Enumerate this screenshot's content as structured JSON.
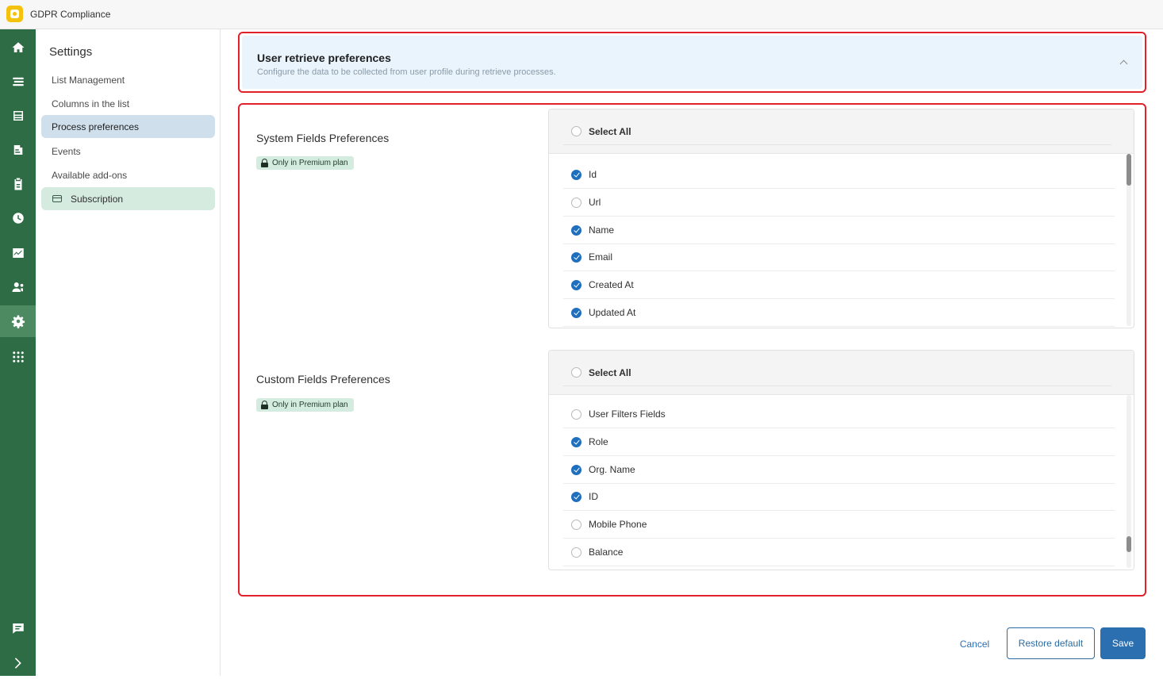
{
  "app": {
    "title": "GDPR Compliance"
  },
  "rail": {
    "items": [
      {
        "icon": "home-icon"
      },
      {
        "icon": "layers-icon"
      },
      {
        "icon": "database-icon"
      },
      {
        "icon": "requests-icon"
      },
      {
        "icon": "clipboard-icon"
      },
      {
        "icon": "clock-icon"
      },
      {
        "icon": "chart-icon"
      },
      {
        "icon": "users-icon"
      },
      {
        "icon": "gear-icon",
        "active": true
      },
      {
        "icon": "apps-icon"
      },
      {
        "icon": "chat-icon"
      },
      {
        "icon": "chevron-right-icon"
      }
    ]
  },
  "sidenav": {
    "title": "Settings",
    "items": [
      {
        "label": "List Management"
      },
      {
        "label": "Columns in the list"
      },
      {
        "label": "Process preferences",
        "active": true
      },
      {
        "label": "Events"
      },
      {
        "label": "Available add-ons"
      },
      {
        "label": "Subscription",
        "icon": "card-icon"
      }
    ]
  },
  "section": {
    "title": "User retrieve preferences",
    "subtitle": "Configure the data to be collected from user profile during retrieve processes."
  },
  "system_fields": {
    "title": "System Fields Preferences",
    "badge": "Only in Premium plan",
    "select_all": {
      "label": "Select All",
      "checked": false
    },
    "fields": [
      {
        "label": "Id",
        "checked": true
      },
      {
        "label": "Url",
        "checked": false
      },
      {
        "label": "Name",
        "checked": true
      },
      {
        "label": "Email",
        "checked": true
      },
      {
        "label": "Created At",
        "checked": true
      },
      {
        "label": "Updated At",
        "checked": true
      }
    ]
  },
  "custom_fields": {
    "title": "Custom Fields Preferences",
    "badge": "Only in Premium plan",
    "select_all": {
      "label": "Select All",
      "checked": false
    },
    "fields": [
      {
        "label": "User Filters Fields",
        "checked": false
      },
      {
        "label": "Role",
        "checked": true
      },
      {
        "label": "Org. Name",
        "checked": true
      },
      {
        "label": "ID",
        "checked": true
      },
      {
        "label": "Mobile Phone",
        "checked": false
      },
      {
        "label": "Balance",
        "checked": false
      }
    ]
  },
  "actions": {
    "cancel": "Cancel",
    "restore": "Restore default",
    "save": "Save"
  }
}
